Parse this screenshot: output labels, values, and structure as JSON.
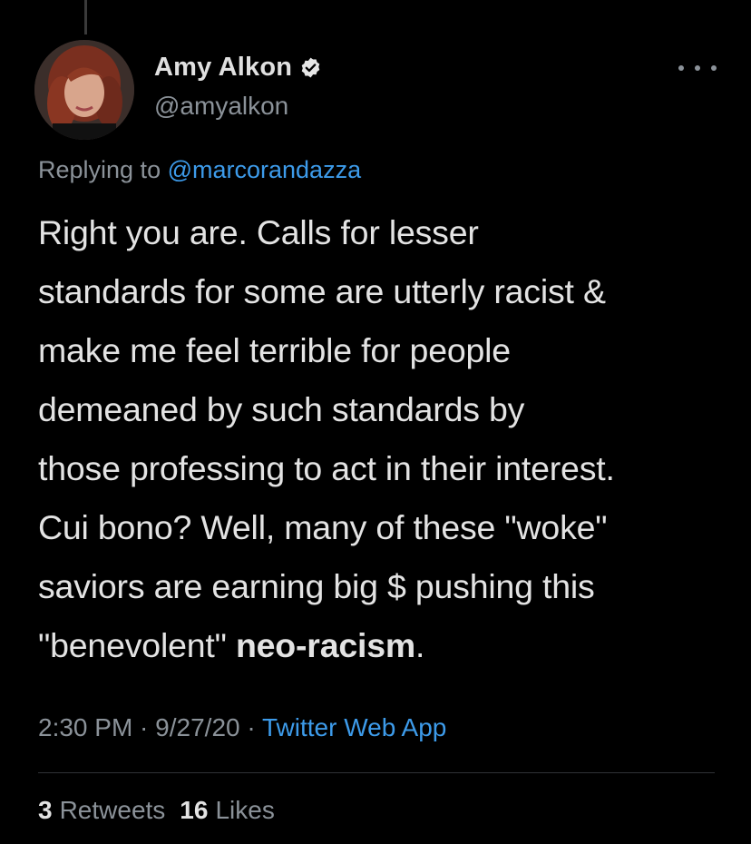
{
  "author": {
    "display_name": "Amy Alkon",
    "handle": "@amyalkon",
    "verified": true
  },
  "reply": {
    "prefix": "Replying to ",
    "mention": "@marcorandazza"
  },
  "tweet": {
    "lines": [
      "Right you are. Calls for lesser",
      "standards for some are utterly racist &",
      "make me feel terrible for people",
      "demeaned by such standards by",
      "those professing to act in their interest.",
      "Cui bono? Well, many of these \"woke\"",
      "saviors are earning big $ pushing this"
    ],
    "last_line_start": "\"benevolent\" ",
    "last_line_bold": "neo-racism",
    "last_line_end": "."
  },
  "meta": {
    "time": "2:30 PM",
    "sep1": " · ",
    "date": "9/27/20",
    "sep2": " · ",
    "source": "Twitter Web App"
  },
  "stats": {
    "retweets_count": "3",
    "retweets_label": "Retweets",
    "likes_count": "16",
    "likes_label": "Likes"
  },
  "icons": {
    "verified": "verified-badge-icon",
    "more": "more-options-icon"
  },
  "colors": {
    "background": "#000000",
    "link": "#3d9bea",
    "muted": "#8b9299"
  }
}
